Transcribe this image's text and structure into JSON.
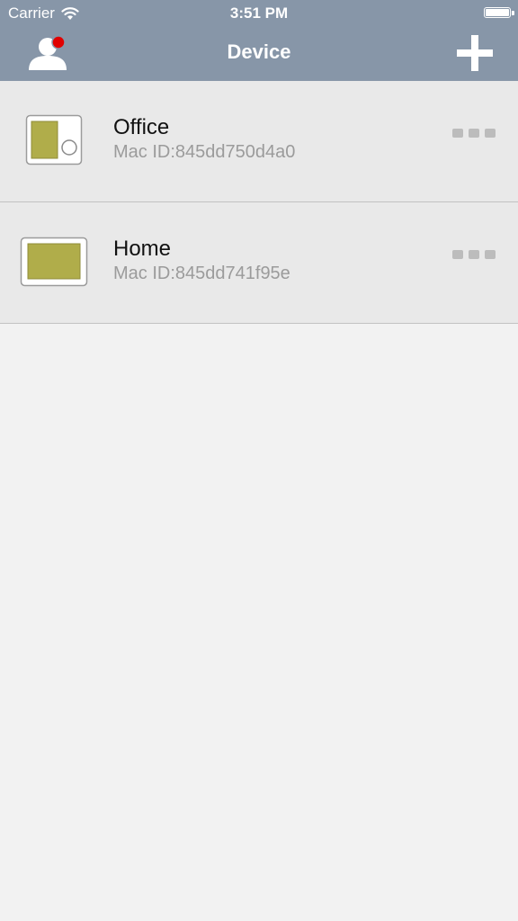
{
  "status_bar": {
    "carrier": "Carrier",
    "time": "3:51 PM"
  },
  "nav": {
    "title": "Device",
    "left_icon": "user-profile-icon",
    "right_icon": "plus-icon",
    "badge_color": "#e10000"
  },
  "devices": [
    {
      "name": "Office",
      "mac": "Mac ID:845dd750d4a0",
      "icon": "vertical-thermostat-icon"
    },
    {
      "name": "Home",
      "mac": "Mac ID:845dd741f95e",
      "icon": "horizontal-thermostat-icon"
    }
  ],
  "colors": {
    "header": "#8796a8",
    "row_bg": "#e9e9e9",
    "page_bg": "#f2f2f2",
    "device_screen": "#b0ad4a"
  }
}
